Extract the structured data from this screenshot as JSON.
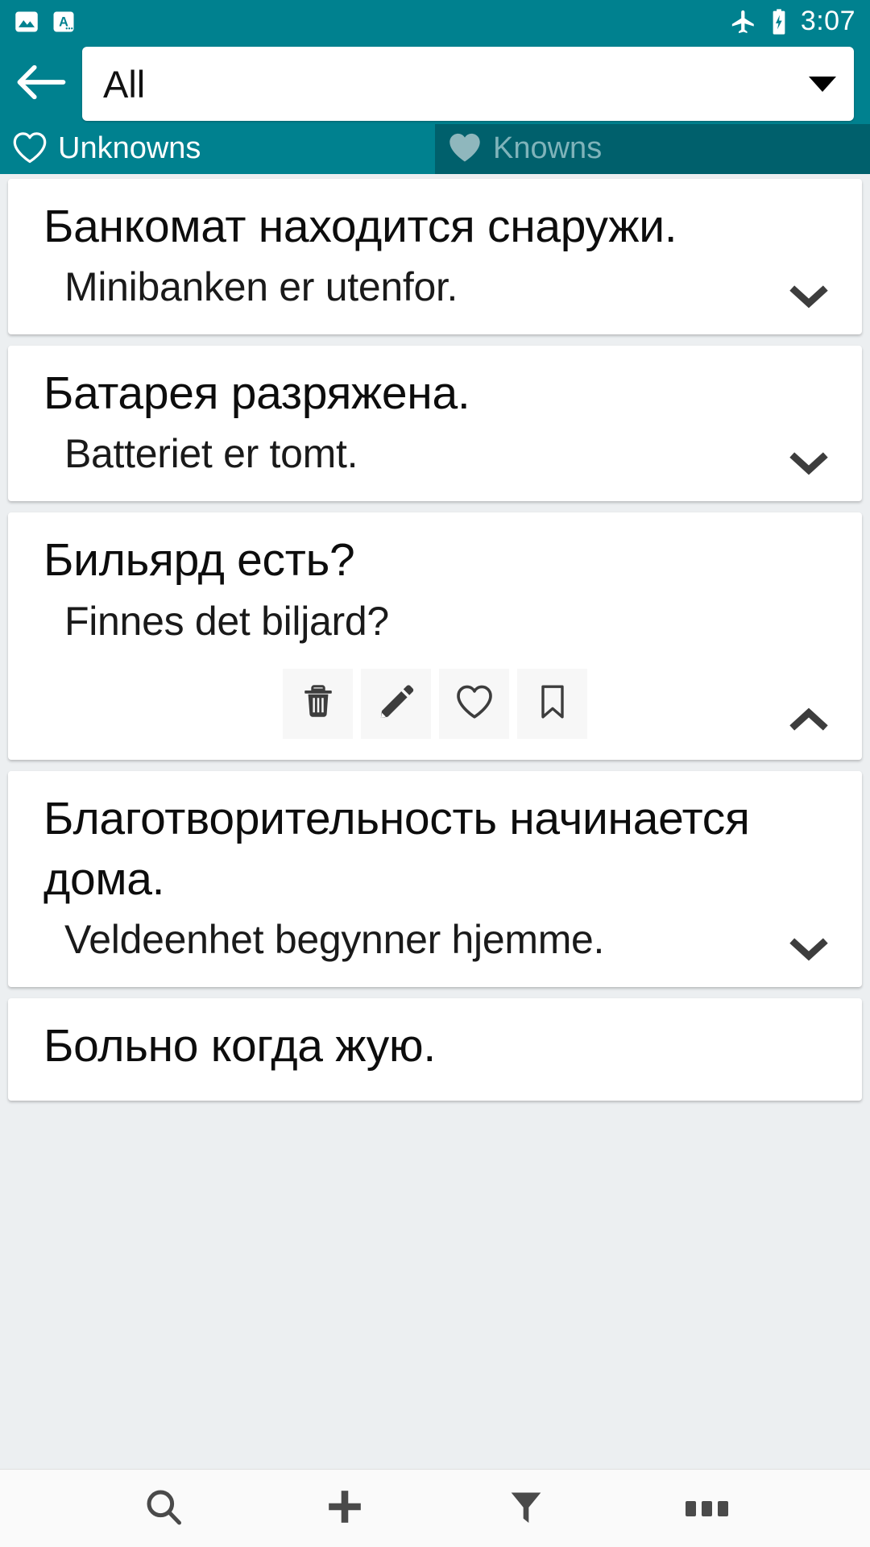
{
  "status_bar": {
    "left_icons": [
      "image-icon",
      "keyboard-language-icon"
    ],
    "right_icons": [
      "airplane-mode-icon",
      "battery-charging-icon"
    ],
    "time": "3:07"
  },
  "app_bar": {
    "back_icon": "arrow-back-icon",
    "spinner": {
      "value": "All",
      "dropdown_icon": "triangle-down-icon"
    }
  },
  "tabs": [
    {
      "label": "Unknowns",
      "icon": "heart-outline-icon",
      "active": true
    },
    {
      "label": "Knowns",
      "icon": "heart-filled-icon",
      "active": false
    }
  ],
  "colors": {
    "accent": "#00818f",
    "tab_inactive_bg": "#00606c",
    "tab_inactive_text": "#7fb3ba",
    "list_bg": "#eceff1",
    "card_bg": "#ffffff",
    "icon_dark": "#424242"
  },
  "cards": [
    {
      "term": "Банкомат находится снаружи.",
      "translation": "Minibanken er utenfor.",
      "expanded": false,
      "toggle_icon": "chevron-down-icon"
    },
    {
      "term": "Батарея разряжена.",
      "translation": "Batteriet er tomt.",
      "expanded": false,
      "toggle_icon": "chevron-down-icon"
    },
    {
      "term": "Бильярд есть?",
      "translation": "Finnes det biljard?",
      "expanded": true,
      "toggle_icon": "chevron-up-icon",
      "actions": [
        {
          "name": "delete-button",
          "icon": "trash-icon"
        },
        {
          "name": "edit-button",
          "icon": "pencil-icon"
        },
        {
          "name": "favorite-button",
          "icon": "heart-outline-icon"
        },
        {
          "name": "bookmark-button",
          "icon": "bookmark-icon"
        }
      ]
    },
    {
      "term": "Благотворительность начинается дома.",
      "translation": "Veldeenhet begynner hjemme.",
      "expanded": false,
      "toggle_icon": "chevron-down-icon"
    },
    {
      "term": "Больно когда жую.",
      "translation": "",
      "expanded": false,
      "toggle_icon": ""
    }
  ],
  "bottom_bar": [
    {
      "name": "search-button",
      "icon": "search-icon"
    },
    {
      "name": "add-button",
      "icon": "plus-icon"
    },
    {
      "name": "filter-button",
      "icon": "funnel-icon"
    },
    {
      "name": "overflow-button",
      "icon": "more-horizontal-icon"
    }
  ]
}
